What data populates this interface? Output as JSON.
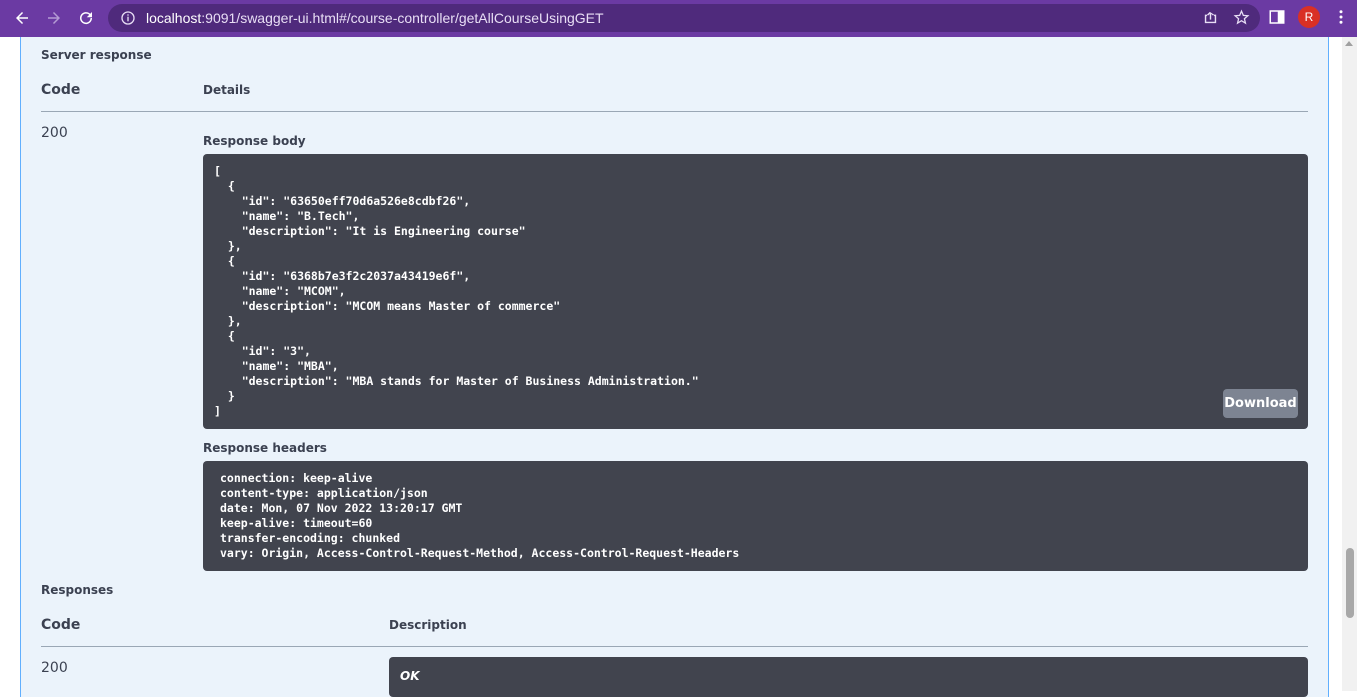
{
  "browser": {
    "url_host": "localhost",
    "url_rest": ":9091/swagger-ui.html#/course-controller/getAllCourseUsingGET",
    "profile_initial": "R"
  },
  "server_response": {
    "heading": "Server response",
    "code_header": "Code",
    "details_header": "Details",
    "code": "200",
    "body_label": "Response body",
    "body_text": "[\n  {\n    \"id\": \"63650eff70d6a526e8cdbf26\",\n    \"name\": \"B.Tech\",\n    \"description\": \"It is Engineering course\"\n  },\n  {\n    \"id\": \"6368b7e3f2c2037a43419e6f\",\n    \"name\": \"MCOM\",\n    \"description\": \"MCOM means Master of commerce\"\n  },\n  {\n    \"id\": \"3\",\n    \"name\": \"MBA\",\n    \"description\": \"MBA stands for Master of Business Administration.\"\n  }\n]",
    "download_label": "Download",
    "headers_label": "Response headers",
    "headers_text": "connection: keep-alive\ncontent-type: application/json\ndate: Mon, 07 Nov 2022 13:20:17 GMT\nkeep-alive: timeout=60\ntransfer-encoding: chunked\nvary: Origin, Access-Control-Request-Method, Access-Control-Request-Headers"
  },
  "responses": {
    "heading": "Responses",
    "code_header": "Code",
    "description_header": "Description",
    "code": "200",
    "description": "OK"
  },
  "colors": {
    "chrome": "#6b3aa3",
    "panel": "#ebf3fb",
    "code_bg": "#41444e"
  }
}
